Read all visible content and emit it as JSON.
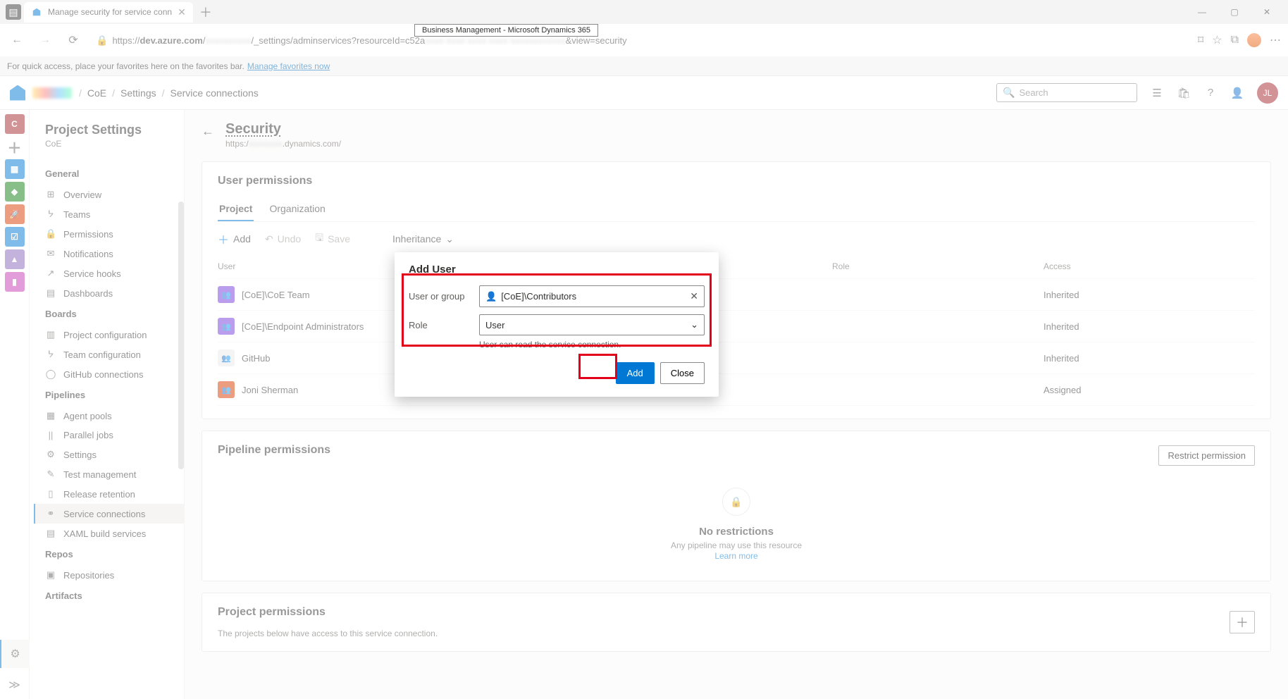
{
  "browser": {
    "tab_title": "Manage security for service conn",
    "tooltip": "Business Management - Microsoft Dynamics 365",
    "url_prefix": "https://",
    "url_host": "dev.azure.com",
    "url_path": "_settings/adminservices?resourceId=c52a",
    "url_tail": "view=security",
    "fav_prompt": "For quick access, place your favorites here on the favorites bar.",
    "fav_link": "Manage favorites now"
  },
  "header": {
    "breadcrumb": [
      "CoE",
      "Settings",
      "Service connections"
    ],
    "search_placeholder": "Search",
    "user_initials": "JL"
  },
  "sidebar": {
    "title": "Project Settings",
    "project": "CoE",
    "sections": [
      {
        "name": "General",
        "items": [
          {
            "label": "Overview",
            "icon": "⊞"
          },
          {
            "label": "Teams",
            "icon": "ᔭ"
          },
          {
            "label": "Permissions",
            "icon": "🔒"
          },
          {
            "label": "Notifications",
            "icon": "✉"
          },
          {
            "label": "Service hooks",
            "icon": "↗"
          },
          {
            "label": "Dashboards",
            "icon": "▤"
          }
        ]
      },
      {
        "name": "Boards",
        "items": [
          {
            "label": "Project configuration",
            "icon": "▥"
          },
          {
            "label": "Team configuration",
            "icon": "ᔭ"
          },
          {
            "label": "GitHub connections",
            "icon": "◯"
          }
        ]
      },
      {
        "name": "Pipelines",
        "items": [
          {
            "label": "Agent pools",
            "icon": "▦"
          },
          {
            "label": "Parallel jobs",
            "icon": "||"
          },
          {
            "label": "Settings",
            "icon": "⚙"
          },
          {
            "label": "Test management",
            "icon": "✎"
          },
          {
            "label": "Release retention",
            "icon": "▯"
          },
          {
            "label": "Service connections",
            "icon": "⚭",
            "active": true
          },
          {
            "label": "XAML build services",
            "icon": "▤"
          }
        ]
      },
      {
        "name": "Repos",
        "items": [
          {
            "label": "Repositories",
            "icon": "▣"
          }
        ]
      },
      {
        "name": "Artifacts",
        "items": []
      }
    ]
  },
  "content": {
    "page_title": "Security",
    "page_sub_prefix": "https:/",
    "page_sub_suffix": ".dynamics.com/",
    "user_permissions": {
      "heading": "User permissions",
      "tabs": {
        "project": "Project",
        "organization": "Organization"
      },
      "toolbar": {
        "add": "Add",
        "undo": "Undo",
        "save": "Save",
        "inheritance": "Inheritance"
      },
      "columns": {
        "user": "User",
        "role": "Role",
        "access": "Access"
      },
      "rows": [
        {
          "name": "[CoE]\\CoE Team",
          "color": "#773adc",
          "access": "Inherited"
        },
        {
          "name": "[CoE]\\Endpoint Administrators",
          "color": "#773adc",
          "access": "Inherited"
        },
        {
          "name": "GitHub",
          "color": "#e8e8e8",
          "access": "Inherited"
        },
        {
          "name": "Joni Sherman",
          "color": "#d83b01",
          "access": "Assigned"
        }
      ]
    },
    "pipeline_permissions": {
      "heading": "Pipeline permissions",
      "restrict_btn": "Restrict permission",
      "empty_title": "No restrictions",
      "empty_sub": "Any pipeline may use this resource",
      "learn_more": "Learn more"
    },
    "project_permissions": {
      "heading": "Project permissions",
      "sub": "The projects below have access to this service connection."
    }
  },
  "modal": {
    "title": "Add User",
    "user_label": "User or group",
    "user_value": "[CoE]\\Contributors",
    "role_label": "Role",
    "role_value": "User",
    "hint": "User can read the service connection.",
    "add_btn": "Add",
    "close_btn": "Close"
  }
}
